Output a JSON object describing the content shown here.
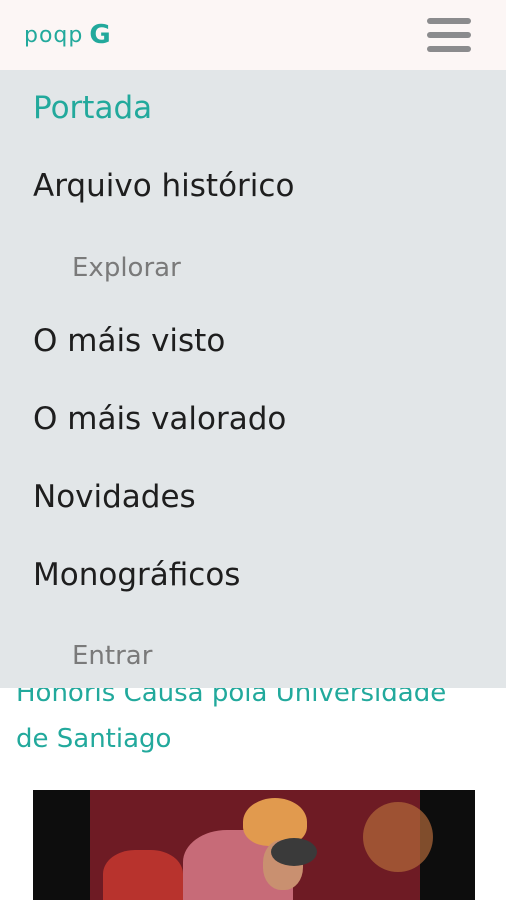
{
  "header": {
    "logo_text": "poqp",
    "logo_mark": "G",
    "menu_icon": "hamburger-icon"
  },
  "menu": {
    "items": [
      {
        "label": "Portada",
        "active": true
      },
      {
        "label": "Arquivo histórico"
      },
      {
        "label": "Explorar",
        "sub": true
      },
      {
        "label": "O máis visto"
      },
      {
        "label": "O máis valorado"
      },
      {
        "label": "Novidades"
      },
      {
        "label": "Monográficos"
      },
      {
        "label": "Entrar",
        "sub": true
      }
    ]
  },
  "content": {
    "headline_line1": "Honoris Causa pola Universidade",
    "headline_line2": "de Santiago"
  },
  "colors": {
    "accent": "#22a99c",
    "menu_bg": "#e2e6e8",
    "topbar_bg": "#fcf6f5"
  }
}
